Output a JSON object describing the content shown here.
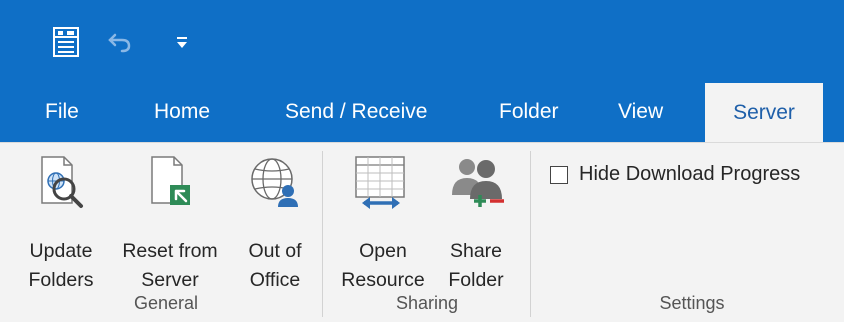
{
  "tabs": [
    {
      "label": "File",
      "active": false
    },
    {
      "label": "Home",
      "active": false
    },
    {
      "label": "Send / Receive",
      "active": false
    },
    {
      "label": "Folder",
      "active": false
    },
    {
      "label": "View",
      "active": false
    },
    {
      "label": "Server",
      "active": true
    }
  ],
  "quick_access": {
    "icons": [
      "send-receive-all-icon",
      "undo-icon",
      "customize-qat-icon"
    ]
  },
  "groups": {
    "general": {
      "label": "General",
      "buttons": [
        {
          "label": "Update\nFolders",
          "icon": "update-folders-icon"
        },
        {
          "label": "Reset from\nServer",
          "icon": "reset-from-server-icon"
        },
        {
          "label": "Out of\nOffice",
          "icon": "out-of-office-icon"
        }
      ]
    },
    "sharing": {
      "label": "Sharing",
      "buttons": [
        {
          "label": "Open\nResource",
          "icon": "open-resource-icon"
        },
        {
          "label": "Share\nFolder",
          "icon": "share-folder-icon"
        }
      ]
    },
    "settings": {
      "label": "Settings",
      "hide_download_progress": {
        "label": "Hide Download Progress",
        "checked": false
      }
    }
  },
  "colors": {
    "accent": "#0f6fc6",
    "ribbon_bg": "#f3f3f3",
    "active_tab_text": "#1e5fa9"
  }
}
